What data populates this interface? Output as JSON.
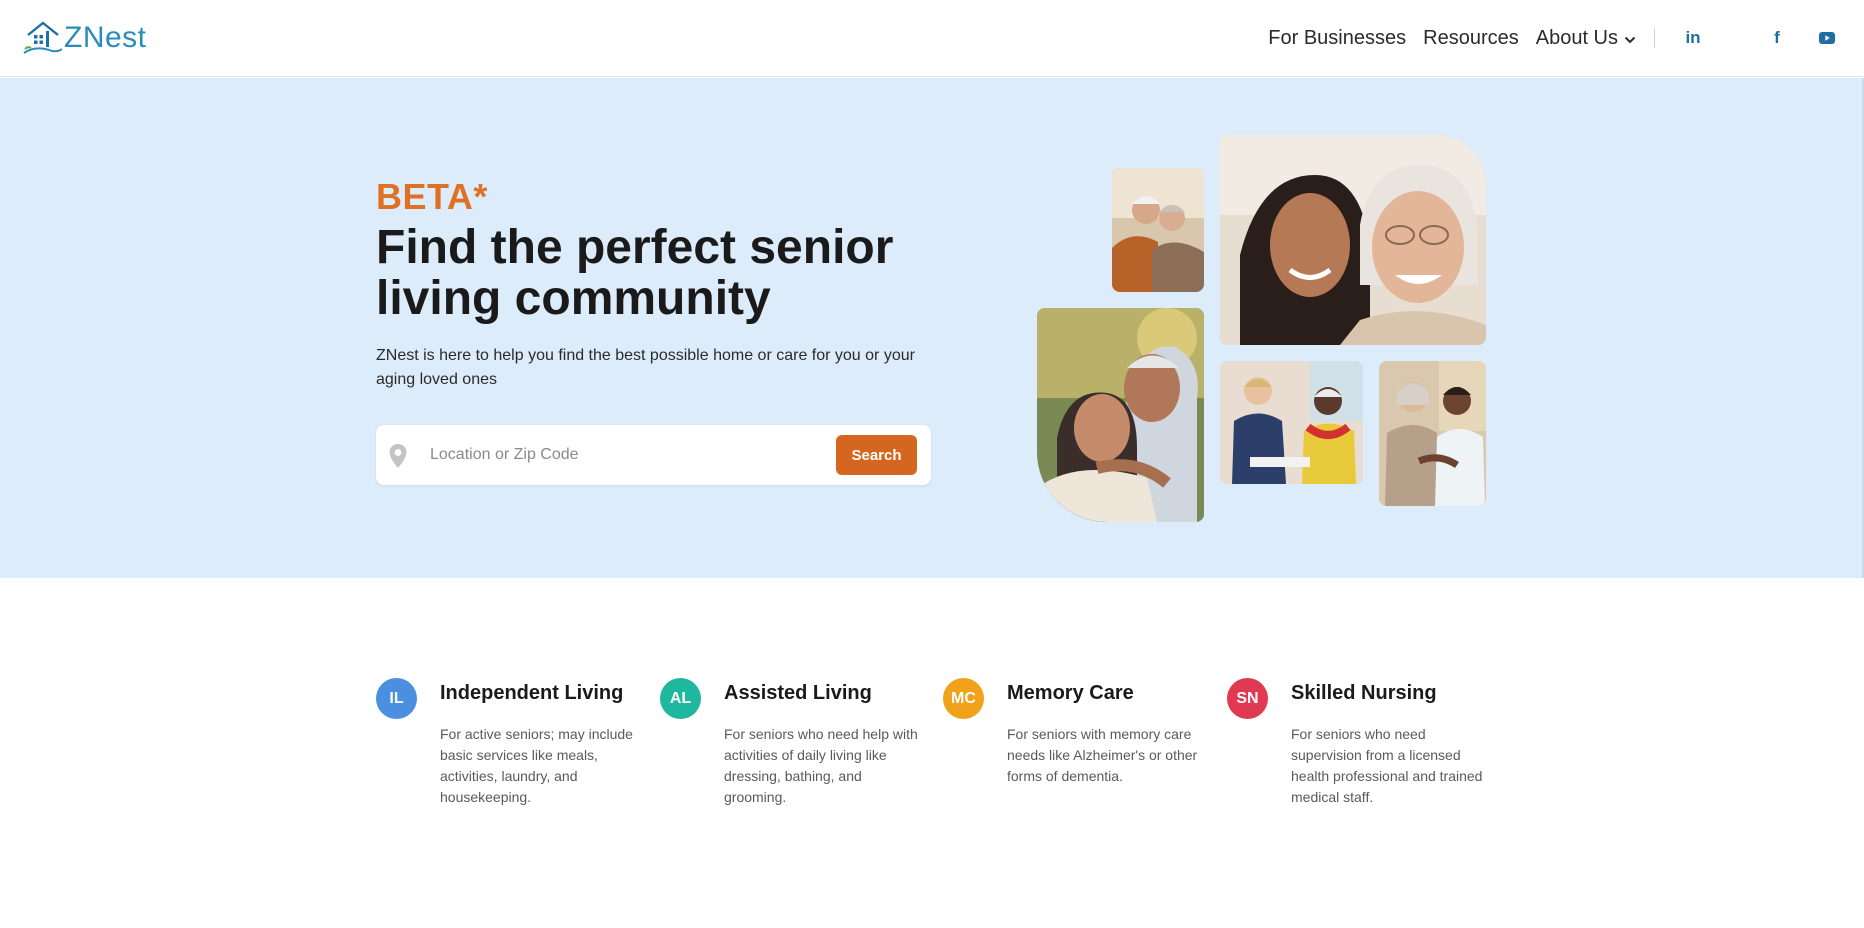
{
  "header": {
    "logo_text": "ZNest",
    "nav": {
      "for_businesses": "For Businesses",
      "resources": "Resources",
      "about_us": "About Us"
    },
    "social": {
      "linkedin": "in",
      "facebook": "f"
    }
  },
  "hero": {
    "badge": "BETA*",
    "title": "Find the perfect senior living community",
    "subtitle": "ZNest is here to help you find the best possible home or care for you or your aging loved ones",
    "search": {
      "placeholder": "Location or Zip Code",
      "button_label": "Search"
    }
  },
  "care_types": [
    {
      "abbr": "IL",
      "title": "Independent Living",
      "description": "For active seniors; may include basic services like meals, activities, laundry, and housekeeping.",
      "color": "#4a8fe0"
    },
    {
      "abbr": "AL",
      "title": "Assisted Living",
      "description": "For seniors who need help with activities of daily living like dressing, bathing, and grooming.",
      "color": "#1fb89e"
    },
    {
      "abbr": "MC",
      "title": "Memory Care",
      "description": "For seniors with memory care needs like Alzheimer's or other forms of dementia.",
      "color": "#f0a21a"
    },
    {
      "abbr": "SN",
      "title": "Skilled Nursing",
      "description": "For seniors who need supervision from a licensed health professional and trained medical staff.",
      "color": "#e03a52"
    }
  ],
  "colors": {
    "brand_blue": "#2a8bbd",
    "accent_orange": "#e07024",
    "hero_bg": "#dcecfb",
    "search_button": "#d4661f"
  },
  "icons": [
    "logo-house-icon",
    "chevron-down-icon",
    "linkedin-icon",
    "facebook-icon",
    "youtube-icon",
    "location-pin-icon"
  ]
}
